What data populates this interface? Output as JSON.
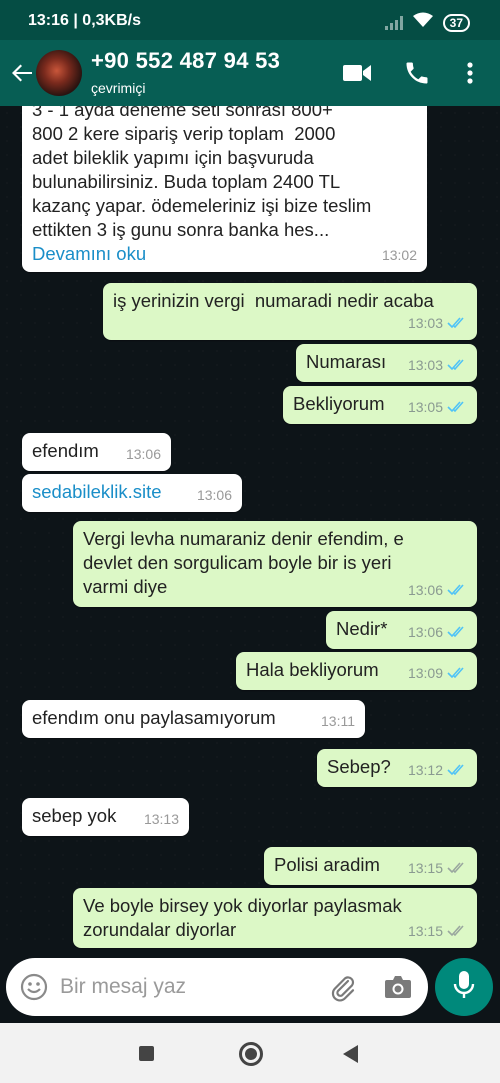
{
  "status_bar": {
    "time": "13:16",
    "network_speed": "0,3KB/s",
    "battery": "37"
  },
  "header": {
    "contact_name": "+90 552 487 94 53",
    "contact_status": "çevrimiçi"
  },
  "messages": [
    {
      "dir": "in",
      "text": "3 - 1 ayda deneme seti sonrası 800+\n800 2 kere sipariş verip toplam  2000\nadet bileklik yapımı için başvuruda\nbulunabilirsiniz. Buda toplam 2400 TL\nkazanç yapar. ödemeleriniz işi bize teslim\nettikten 3 iş gunu sonra banka hes...",
      "more": "Devamını oku",
      "time": "13:02"
    },
    {
      "dir": "out",
      "text": "iş yerinizin vergi  numaradi nedir acaba",
      "time": "13:03",
      "status": "read"
    },
    {
      "dir": "out",
      "text": "Numarası",
      "time": "13:03",
      "status": "read"
    },
    {
      "dir": "out",
      "text": "Bekliyorum",
      "time": "13:05",
      "status": "read"
    },
    {
      "dir": "in",
      "text": "efendım",
      "time": "13:06"
    },
    {
      "dir": "in",
      "text": "sedabileklik.site",
      "time": "13:06",
      "link": true
    },
    {
      "dir": "out",
      "text": "Vergi levha numaraniz denir efendim, e\ndevlet den sorgulicam boyle bir is yeri\nvarmi diye",
      "time": "13:06",
      "status": "read"
    },
    {
      "dir": "out",
      "text": "Nedir*",
      "time": "13:06",
      "status": "read"
    },
    {
      "dir": "out",
      "text": "Hala bekliyorum",
      "time": "13:09",
      "status": "read"
    },
    {
      "dir": "in",
      "text": "efendım onu paylasamıyorum",
      "time": "13:11"
    },
    {
      "dir": "out",
      "text": "Sebep?",
      "time": "13:12",
      "status": "read"
    },
    {
      "dir": "in",
      "text": "sebep yok",
      "time": "13:13"
    },
    {
      "dir": "out",
      "text": "Polisi aradim",
      "time": "13:15",
      "status": "delivered"
    },
    {
      "dir": "out",
      "text": "Ve boyle birsey yok diyorlar paylasmak\nzorundalar diyorlar",
      "time": "13:15",
      "status": "delivered"
    }
  ],
  "input": {
    "placeholder": "Bir mesaj yaz"
  },
  "icons": {
    "back": "arrow-left-icon",
    "video": "video-call-icon",
    "call": "phone-icon",
    "menu": "more-vert-icon",
    "emoji": "emoji-icon",
    "attach": "paperclip-icon",
    "camera": "camera-icon",
    "mic": "mic-icon"
  },
  "colors": {
    "header": "#075e54",
    "status_bar": "#054d44",
    "chat_bg": "#0d1418",
    "outgoing_bubble": "#dcf8c6",
    "incoming_bubble": "#ffffff",
    "read_tick": "#4fc3f7",
    "delivered_tick": "#9aa79f",
    "link": "#1a8ec8",
    "mic_button": "#00897b"
  }
}
